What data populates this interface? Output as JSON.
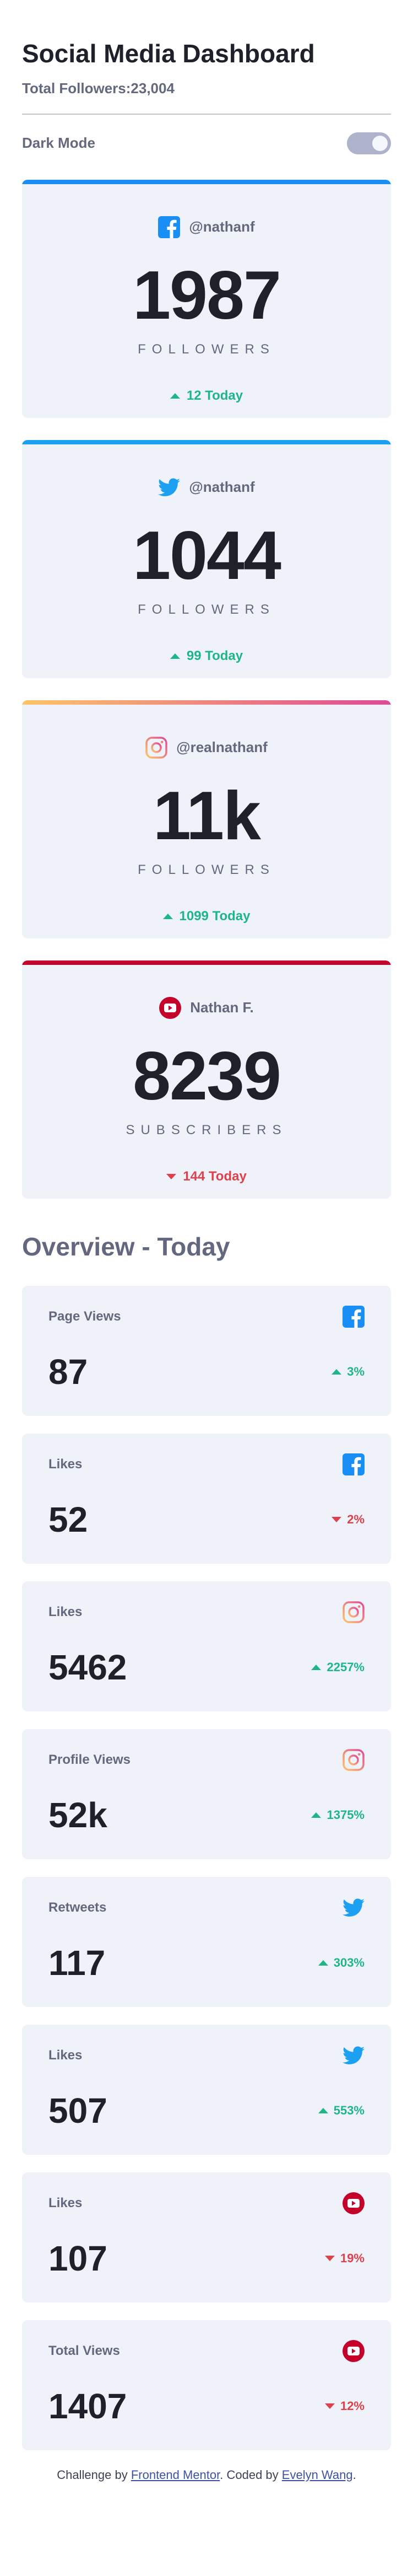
{
  "header": {
    "title": "Social Media Dashboard",
    "total_followers": "Total Followers:23,004",
    "dark_mode_label": "Dark Mode"
  },
  "colors": {
    "facebook": "#198ff5",
    "twitter": "#1ca0f2",
    "instagram_start": "#fdc468",
    "instagram_end": "#df4996",
    "youtube": "#c4032a",
    "up": "#1eb589",
    "down": "#dc414c"
  },
  "cards": [
    {
      "network": "facebook",
      "icon": "facebook-icon",
      "handle": "@nathanf",
      "count": "1987",
      "unit": "Followers",
      "today": "12 Today",
      "trend": "up"
    },
    {
      "network": "twitter",
      "icon": "twitter-icon",
      "handle": "@nathanf",
      "count": "1044",
      "unit": "Followers",
      "today": "99 Today",
      "trend": "up"
    },
    {
      "network": "instagram",
      "icon": "instagram-icon",
      "handle": "@realnathanf",
      "count": "11k",
      "unit": "Followers",
      "today": "1099 Today",
      "trend": "up"
    },
    {
      "network": "youtube",
      "icon": "youtube-icon",
      "handle": "Nathan F.",
      "count": "8239",
      "unit": "Subscribers",
      "today": "144 Today",
      "trend": "down"
    }
  ],
  "overview": {
    "title": "Overview - Today",
    "items": [
      {
        "metric": "Page Views",
        "network": "facebook",
        "icon": "facebook-icon",
        "value": "87",
        "pct": "3%",
        "trend": "up"
      },
      {
        "metric": "Likes",
        "network": "facebook",
        "icon": "facebook-icon",
        "value": "52",
        "pct": "2%",
        "trend": "down"
      },
      {
        "metric": "Likes",
        "network": "instagram",
        "icon": "instagram-icon",
        "value": "5462",
        "pct": "2257%",
        "trend": "up"
      },
      {
        "metric": "Profile Views",
        "network": "instagram",
        "icon": "instagram-icon",
        "value": "52k",
        "pct": "1375%",
        "trend": "up"
      },
      {
        "metric": "Retweets",
        "network": "twitter",
        "icon": "twitter-icon",
        "value": "117",
        "pct": "303%",
        "trend": "up"
      },
      {
        "metric": "Likes",
        "network": "twitter",
        "icon": "twitter-icon",
        "value": "507",
        "pct": "553%",
        "trend": "up"
      },
      {
        "metric": "Likes",
        "network": "youtube",
        "icon": "youtube-icon",
        "value": "107",
        "pct": "19%",
        "trend": "down"
      },
      {
        "metric": "Total Views",
        "network": "youtube",
        "icon": "youtube-icon",
        "value": "1407",
        "pct": "12%",
        "trend": "down"
      }
    ]
  },
  "footer": {
    "prefix": "Challenge by ",
    "link1": "Frontend Mentor",
    "middle": ". Coded by ",
    "link2": "Evelyn Wang",
    "suffix": "."
  }
}
